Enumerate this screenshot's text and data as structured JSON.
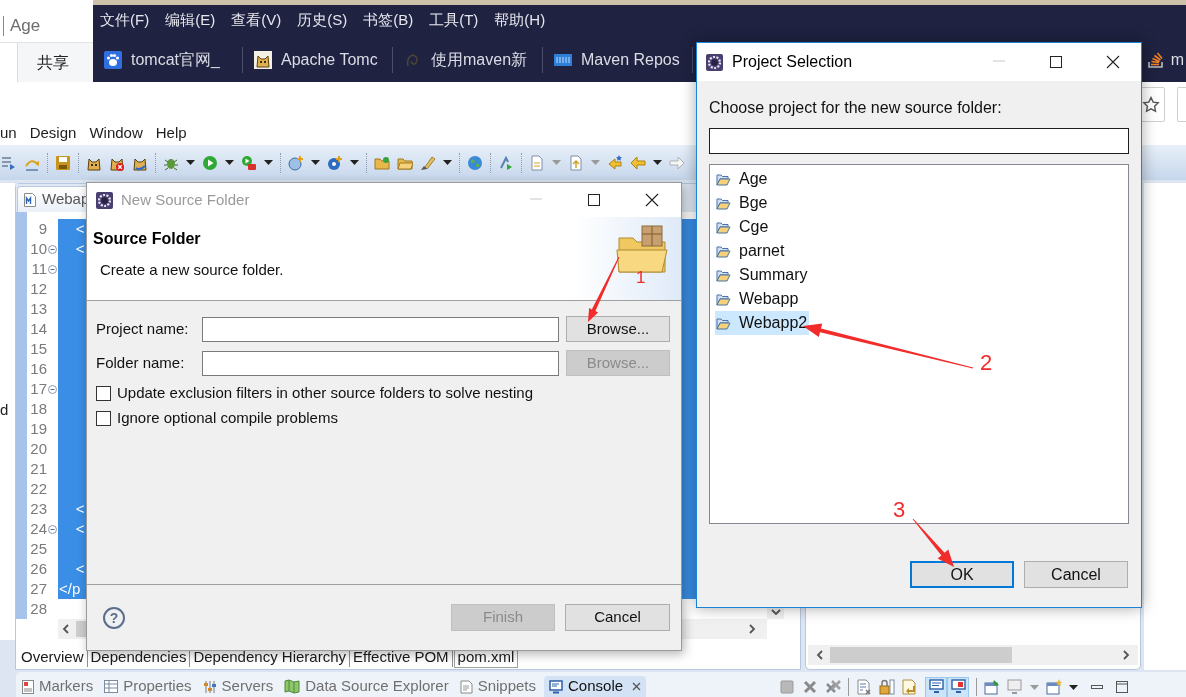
{
  "explorer_window": {
    "address_text": "Age",
    "ribbon_tabs": [
      {
        "label": "共享",
        "selected": false
      }
    ]
  },
  "browser": {
    "menu": [
      "文件(F)",
      "编辑(E)",
      "查看(V)",
      "历史(S)",
      "书签(B)",
      "工具(T)",
      "帮助(H)"
    ],
    "bookmarks": [
      {
        "title": "tomcat官网_"
      },
      {
        "title": "Apache Tomc"
      },
      {
        "title": "使用maven新"
      },
      {
        "title": "Maven Repos"
      },
      {
        "title": "m"
      }
    ]
  },
  "eclipse": {
    "menu": [
      "un",
      "Design",
      "Window",
      "Help"
    ],
    "side_panel_text": "d",
    "editor_tab": {
      "label": "Webap"
    },
    "lines": [
      {
        "number": "9",
        "text": "    <",
        "selected": true,
        "foldable": false
      },
      {
        "number": "10",
        "text": "    <",
        "selected": true,
        "foldable": true
      },
      {
        "number": "11",
        "selected": true,
        "foldable": true
      },
      {
        "number": "12",
        "selected": true,
        "foldable": false
      },
      {
        "number": "13",
        "selected": true,
        "foldable": false
      },
      {
        "number": "14",
        "selected": true,
        "foldable": false
      },
      {
        "number": "15",
        "selected": true,
        "foldable": false
      },
      {
        "number": "16",
        "selected": true,
        "foldable": false
      },
      {
        "number": "17",
        "selected": true,
        "foldable": true
      },
      {
        "number": "18",
        "selected": true,
        "foldable": false
      },
      {
        "number": "19",
        "selected": true,
        "foldable": false
      },
      {
        "number": "20",
        "selected": true,
        "foldable": false
      },
      {
        "number": "21",
        "selected": true,
        "foldable": false
      },
      {
        "number": "22",
        "selected": true,
        "foldable": false
      },
      {
        "number": "23",
        "text": "    <",
        "selected": true,
        "foldable": false
      },
      {
        "number": "24",
        "text": "    <",
        "selected": true,
        "foldable": true
      },
      {
        "number": "25",
        "selected": true,
        "foldable": false
      },
      {
        "number": "26",
        "text": "    <",
        "selected": true,
        "foldable": false
      },
      {
        "number": "27",
        "text": "</p",
        "selected": true,
        "foldable": false
      },
      {
        "number": "28",
        "selected": false,
        "foldable": false
      }
    ],
    "editor_tabs": [
      {
        "label": "Overview",
        "selected": false
      },
      {
        "label": "Dependencies",
        "selected": false
      },
      {
        "label": "Dependency Hierarchy",
        "selected": false
      },
      {
        "label": "Effective POM",
        "selected": false
      },
      {
        "label": "pom.xml",
        "selected": true
      }
    ],
    "views": [
      {
        "label": "Markers",
        "selected": false
      },
      {
        "label": "Properties",
        "selected": false
      },
      {
        "label": "Servers",
        "selected": false
      },
      {
        "label": "Data Source Explorer",
        "selected": false
      },
      {
        "label": "Snippets",
        "selected": false
      },
      {
        "label": "Console",
        "selected": true
      }
    ],
    "console_toggles": [
      {
        "pressed": true
      },
      {
        "pressed": true
      }
    ]
  },
  "new_source_folder_dialog": {
    "title": "New Source Folder",
    "active": false,
    "heading": "Source Folder",
    "description": "Create a new source folder.",
    "fields": [
      {
        "label": "Project name:",
        "button": "Browse...",
        "button_disabled": false
      },
      {
        "label": "Folder name:",
        "button": "Browse...",
        "button_disabled": true
      }
    ],
    "options": [
      {
        "label": "Update exclusion filters in other source folders to solve nesting",
        "checked": false
      },
      {
        "label": "Ignore optional compile problems",
        "checked": false
      }
    ],
    "help": "?",
    "buttons": [
      {
        "label": "Finish",
        "disabled": true
      },
      {
        "label": "Cancel",
        "disabled": false
      }
    ]
  },
  "project_selection_dialog": {
    "title": "Project Selection",
    "active": true,
    "prompt": "Choose project for the new source folder:",
    "projects": [
      {
        "name": "Age",
        "selected": false
      },
      {
        "name": "Bge",
        "selected": false
      },
      {
        "name": "Cge",
        "selected": false
      },
      {
        "name": "parnet",
        "selected": false
      },
      {
        "name": "Summary",
        "selected": false
      },
      {
        "name": "Webapp",
        "selected": false
      },
      {
        "name": "Webapp2",
        "selected": true
      }
    ],
    "buttons": [
      {
        "label": "OK",
        "default": true
      },
      {
        "label": "Cancel",
        "default": false
      }
    ]
  },
  "annotations": [
    {
      "label": "1"
    },
    {
      "label": "2"
    },
    {
      "label": "3"
    }
  ]
}
